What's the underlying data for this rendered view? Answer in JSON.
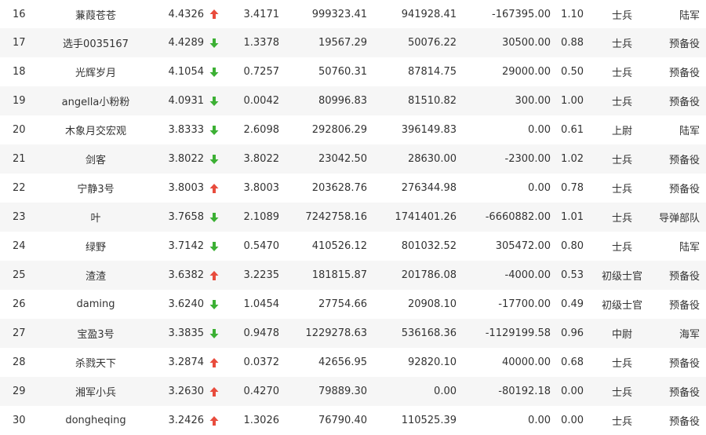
{
  "colors": {
    "up": "#e84c3d",
    "down": "#3cb034",
    "text": "#333333",
    "stripe": "#f6f6f6"
  },
  "rows": [
    {
      "rank": "16",
      "name": "蒹葭苍苍",
      "score": "4.4326",
      "trend": "up",
      "v1": "3.4171",
      "v2": "999323.41",
      "v3": "941928.41",
      "v4": "-167395.00",
      "v5": "1.10",
      "title": "士兵",
      "branch": "陆军"
    },
    {
      "rank": "17",
      "name": "选手0035167",
      "score": "4.4289",
      "trend": "down",
      "v1": "1.3378",
      "v2": "19567.29",
      "v3": "50076.22",
      "v4": "30500.00",
      "v5": "0.88",
      "title": "士兵",
      "branch": "预备役"
    },
    {
      "rank": "18",
      "name": "光辉岁月",
      "score": "4.1054",
      "trend": "down",
      "v1": "0.7257",
      "v2": "50760.31",
      "v3": "87814.75",
      "v4": "29000.00",
      "v5": "0.50",
      "title": "士兵",
      "branch": "预备役"
    },
    {
      "rank": "19",
      "name": "angella小粉粉",
      "score": "4.0931",
      "trend": "down",
      "v1": "0.0042",
      "v2": "80996.83",
      "v3": "81510.82",
      "v4": "300.00",
      "v5": "1.00",
      "title": "士兵",
      "branch": "预备役"
    },
    {
      "rank": "20",
      "name": "木象月交宏观",
      "score": "3.8333",
      "trend": "down",
      "v1": "2.6098",
      "v2": "292806.29",
      "v3": "396149.83",
      "v4": "0.00",
      "v5": "0.61",
      "title": "上尉",
      "branch": "陆军"
    },
    {
      "rank": "21",
      "name": "剑客",
      "score": "3.8022",
      "trend": "down",
      "v1": "3.8022",
      "v2": "23042.50",
      "v3": "28630.00",
      "v4": "-2300.00",
      "v5": "1.02",
      "title": "士兵",
      "branch": "预备役"
    },
    {
      "rank": "22",
      "name": "宁静3号",
      "score": "3.8003",
      "trend": "up",
      "v1": "3.8003",
      "v2": "203628.76",
      "v3": "276344.98",
      "v4": "0.00",
      "v5": "0.78",
      "title": "士兵",
      "branch": "预备役"
    },
    {
      "rank": "23",
      "name": "叶",
      "score": "3.7658",
      "trend": "down",
      "v1": "2.1089",
      "v2": "7242758.16",
      "v3": "1741401.26",
      "v4": "-6660882.00",
      "v5": "1.01",
      "title": "士兵",
      "branch": "导弹部队"
    },
    {
      "rank": "24",
      "name": "绿野",
      "score": "3.7142",
      "trend": "down",
      "v1": "0.5470",
      "v2": "410526.12",
      "v3": "801032.52",
      "v4": "305472.00",
      "v5": "0.80",
      "title": "士兵",
      "branch": "陆军"
    },
    {
      "rank": "25",
      "name": "渣渣",
      "score": "3.6382",
      "trend": "up",
      "v1": "3.2235",
      "v2": "181815.87",
      "v3": "201786.08",
      "v4": "-4000.00",
      "v5": "0.53",
      "title": "初级士官",
      "branch": "预备役"
    },
    {
      "rank": "26",
      "name": "daming",
      "score": "3.6240",
      "trend": "down",
      "v1": "1.0454",
      "v2": "27754.66",
      "v3": "20908.10",
      "v4": "-17700.00",
      "v5": "0.49",
      "title": "初级士官",
      "branch": "预备役"
    },
    {
      "rank": "27",
      "name": "宝盈3号",
      "score": "3.3835",
      "trend": "down",
      "v1": "0.9478",
      "v2": "1229278.63",
      "v3": "536168.36",
      "v4": "-1129199.58",
      "v5": "0.96",
      "title": "中尉",
      "branch": "海军"
    },
    {
      "rank": "28",
      "name": "杀戮天下",
      "score": "3.2874",
      "trend": "up",
      "v1": "0.0372",
      "v2": "42656.95",
      "v3": "92820.10",
      "v4": "40000.00",
      "v5": "0.68",
      "title": "士兵",
      "branch": "预备役"
    },
    {
      "rank": "29",
      "name": "湘军小兵",
      "score": "3.2630",
      "trend": "up",
      "v1": "0.4270",
      "v2": "79889.30",
      "v3": "0.00",
      "v4": "-80192.18",
      "v5": "0.00",
      "title": "士兵",
      "branch": "预备役"
    },
    {
      "rank": "30",
      "name": "dongheqing",
      "score": "3.2426",
      "trend": "up",
      "v1": "1.3026",
      "v2": "76790.40",
      "v3": "110525.39",
      "v4": "0.00",
      "v5": "0.00",
      "title": "士兵",
      "branch": "预备役"
    }
  ]
}
